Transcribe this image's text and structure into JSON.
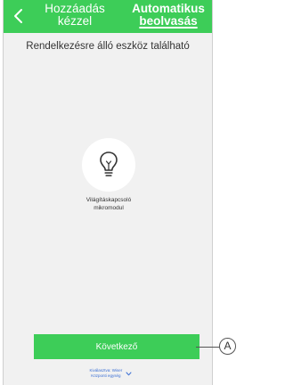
{
  "header": {
    "manual_tab": {
      "line1": "Hozzáadás",
      "line2": "kézzel"
    },
    "auto_tab": {
      "line1": "Automatikus",
      "line2": "beolvasás"
    },
    "back_icon": "chevron-left-icon"
  },
  "main": {
    "headline": "Rendelkezésre álló eszköz található",
    "device": {
      "icon": "lightbulb-icon",
      "name_line1": "Világításkapcsoló",
      "name_line2": "mikromodul"
    },
    "next_button_label": "Következő",
    "hint": {
      "line1": "Kiválasztva: Wiser",
      "line2": "Központi egység",
      "icon": "chevron-down-icon"
    }
  },
  "annotation": {
    "callout_label": "A"
  },
  "colors": {
    "brand_green": "#3dcd58",
    "background": "#f1f1f1",
    "link_blue": "#3b6fd4"
  }
}
